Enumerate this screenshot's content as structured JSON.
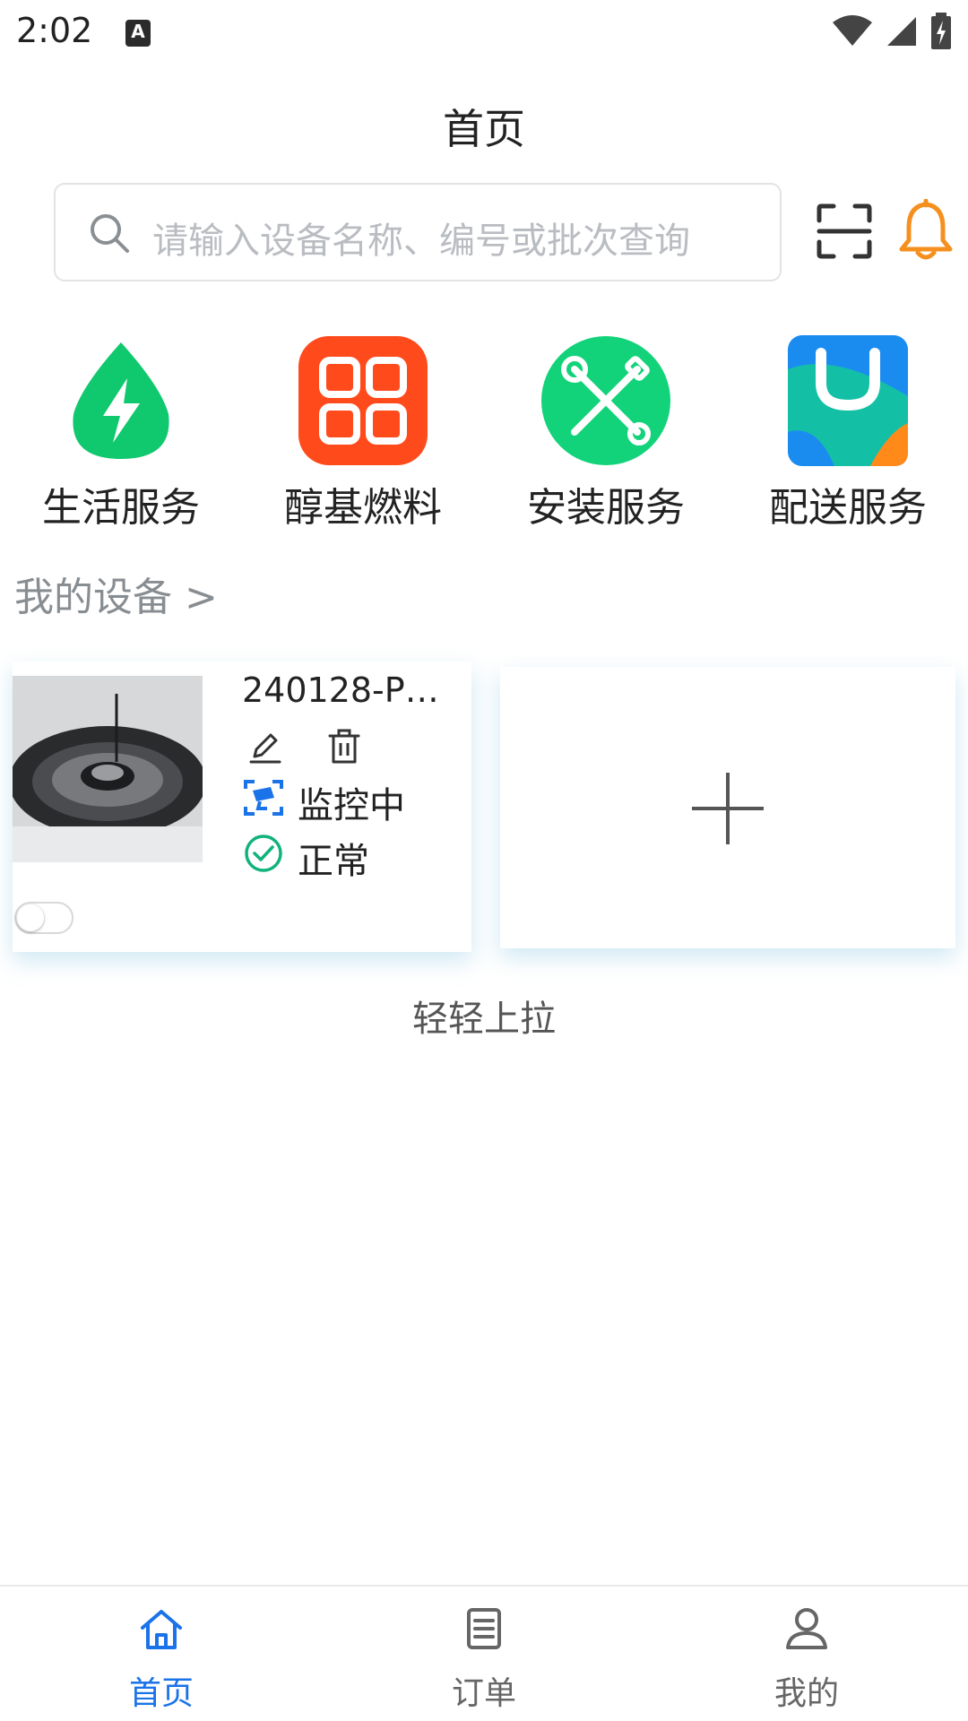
{
  "status_bar": {
    "time": "2:02",
    "notification_icon": "a-icon",
    "icons": [
      "wifi-icon",
      "signal-icon",
      "battery-charging-icon"
    ]
  },
  "header": {
    "title": "首页"
  },
  "search": {
    "placeholder": "请输入设备名称、编号或批次查询",
    "icon": "search-icon",
    "scan_icon": "scan-icon",
    "bell_icon": "bell-icon",
    "bell_color": "#f5901e"
  },
  "services": [
    {
      "label": "生活服务",
      "icon": "water-drop-lightning-icon",
      "color": "#10c86e"
    },
    {
      "label": "醇基燃料",
      "icon": "grid-icon",
      "color": "#ff4a1c"
    },
    {
      "label": "安装服务",
      "icon": "tools-icon",
      "color": "#12d37a"
    },
    {
      "label": "配送服务",
      "icon": "shopping-bag-icon",
      "color": "#1a8cf0"
    }
  ],
  "my_devices": {
    "title": "我的设备 >",
    "devices": [
      {
        "name": "240128-PW…",
        "monitor_status": "监控中",
        "health_status": "正常",
        "toggle_on": false
      }
    ],
    "add_icon": "plus-icon"
  },
  "pull_hint": "轻轻上拉",
  "bottom_nav": {
    "items": [
      {
        "label": "首页",
        "icon": "home-icon",
        "active": true
      },
      {
        "label": "订单",
        "icon": "order-list-icon",
        "active": false
      },
      {
        "label": "我的",
        "icon": "user-icon",
        "active": false
      }
    ],
    "active_color": "#1a73e8"
  }
}
